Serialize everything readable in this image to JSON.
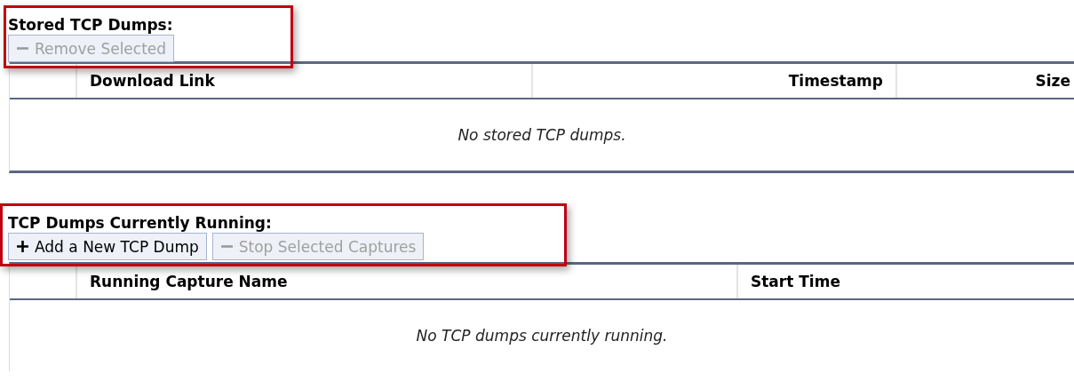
{
  "sections": [
    {
      "title": "Stored TCP Dumps:",
      "highlighted": true,
      "buttons": [
        {
          "label": "Remove Selected",
          "kind": "remove",
          "disabled": true
        }
      ],
      "table": {
        "columns": [
          "Download Link",
          "Timestamp",
          "Size"
        ],
        "empty_message": "No stored TCP dumps."
      }
    },
    {
      "title": "TCP Dumps Currently Running:",
      "highlighted": true,
      "buttons": [
        {
          "label": "Add a New TCP Dump",
          "kind": "add",
          "disabled": false
        },
        {
          "label": "Stop Selected Captures",
          "kind": "remove",
          "disabled": true
        }
      ],
      "table": {
        "columns": [
          "Running Capture Name",
          "Start Time"
        ],
        "empty_message": "No TCP dumps currently running."
      }
    }
  ]
}
